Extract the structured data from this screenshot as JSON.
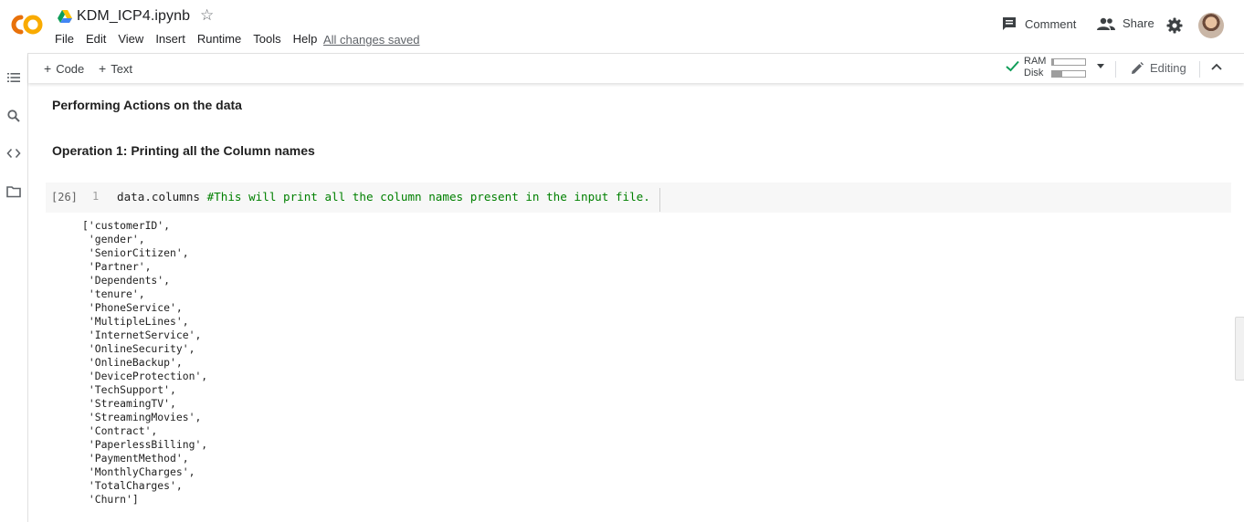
{
  "header": {
    "notebook_title": "KDM_ICP4.ipynb",
    "menu": [
      "File",
      "Edit",
      "View",
      "Insert",
      "Runtime",
      "Tools",
      "Help"
    ],
    "save_status": "All changes saved",
    "comment_label": "Comment",
    "share_label": "Share"
  },
  "toolbar": {
    "add_code_label": "Code",
    "add_text_label": "Text",
    "ram_label": "RAM",
    "disk_label": "Disk",
    "ram_usage": 0.05,
    "disk_usage": 0.3,
    "editing_label": "Editing"
  },
  "notebook": {
    "heading_1": "Performing Actions on the data",
    "heading_2": "Operation 1: Printing all the Column names",
    "cell": {
      "exec_count": "[26]",
      "line_number": "1",
      "code_text": "data.columns ",
      "code_comment": "#This will print all the column names present in the input file."
    },
    "output_lines": [
      "['customerID',",
      " 'gender',",
      " 'SeniorCitizen',",
      " 'Partner',",
      " 'Dependents',",
      " 'tenure',",
      " 'PhoneService',",
      " 'MultipleLines',",
      " 'InternetService',",
      " 'OnlineSecurity',",
      " 'OnlineBackup',",
      " 'DeviceProtection',",
      " 'TechSupport',",
      " 'StreamingTV',",
      " 'StreamingMovies',",
      " 'Contract',",
      " 'PaperlessBilling',",
      " 'PaymentMethod',",
      " 'MonthlyCharges',",
      " 'TotalCharges',",
      " 'Churn']"
    ]
  },
  "colors": {
    "colab_orange": "#F9AB00",
    "colab_orange_dark": "#E8710A",
    "comment_green": "#008000",
    "check_green": "#0F9D58"
  }
}
